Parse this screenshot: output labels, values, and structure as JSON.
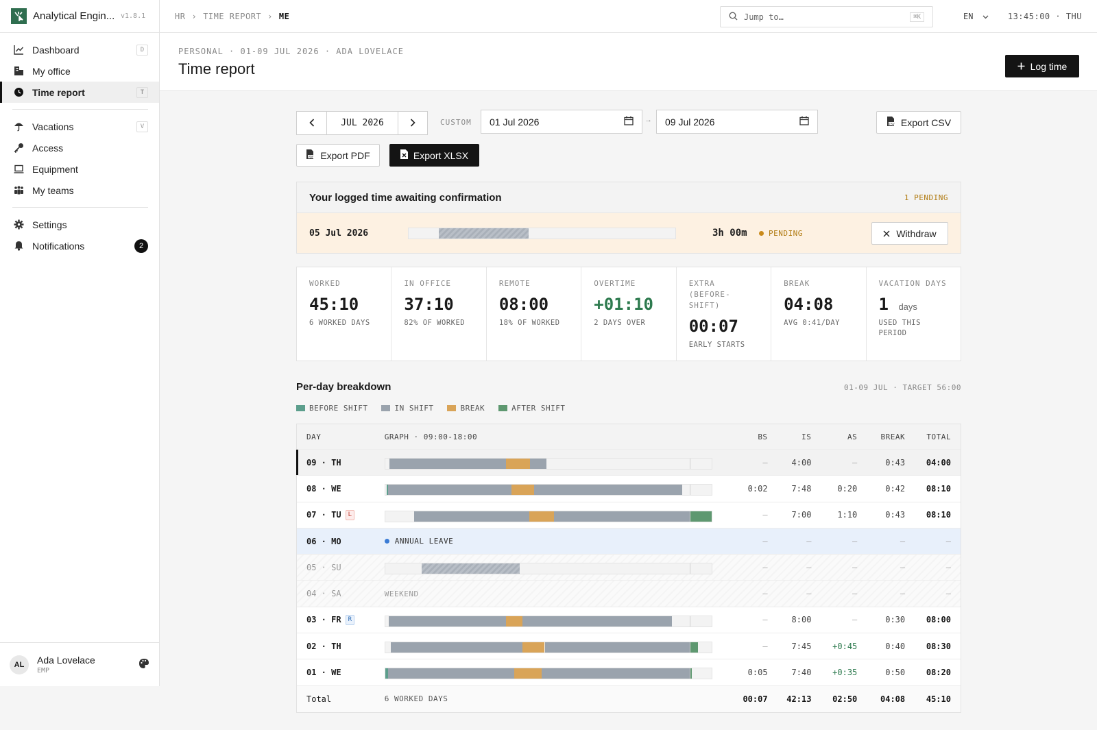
{
  "app": {
    "name": "Analytical Engin...",
    "version": "v1.8.1"
  },
  "sidebar": {
    "items": [
      {
        "label": "Dashboard",
        "kbd": "D",
        "icon": "chart-line-icon"
      },
      {
        "label": "My office",
        "kbd": "",
        "icon": "building-icon"
      },
      {
        "label": "Time report",
        "kbd": "T",
        "icon": "clock-icon"
      },
      {
        "label": "Vacations",
        "kbd": "V",
        "icon": "umbrella-icon"
      },
      {
        "label": "Access",
        "kbd": "",
        "icon": "key-icon"
      },
      {
        "label": "Equipment",
        "kbd": "",
        "icon": "laptop-icon"
      },
      {
        "label": "My teams",
        "kbd": "",
        "icon": "users-icon"
      },
      {
        "label": "Settings",
        "kbd": "",
        "icon": "gear-icon"
      },
      {
        "label": "Notifications",
        "badge": "2",
        "icon": "bell-icon"
      }
    ],
    "user": {
      "initials": "AL",
      "name": "Ada Lovelace",
      "role": "EMP"
    }
  },
  "topbar": {
    "breadcrumb": [
      "HR",
      "TIME REPORT",
      "ME"
    ],
    "search_placeholder": "Jump to…",
    "search_kbd": "⌘K",
    "lang": "EN",
    "clock": "13:45:00 · THU"
  },
  "page": {
    "pretitle": "PERSONAL · 01-09 JUL 2026 · ADA LOVELACE",
    "title": "Time report",
    "log_time": "Log time"
  },
  "controls": {
    "month": "JUL 2026",
    "range_label": "CUSTOM",
    "from": "01 Jul 2026",
    "to": "09 Jul 2026",
    "arrow": "→",
    "export_csv": "Export CSV",
    "export_pdf": "Export PDF",
    "export_xlsx": "Export XLSX"
  },
  "pending": {
    "title": "Your logged time awaiting confirmation",
    "count": "1 PENDING",
    "entry": {
      "date": "05 Jul 2026",
      "duration": "3h 00m",
      "status": "PENDING",
      "withdraw": "Withdraw"
    }
  },
  "stats": [
    {
      "label": "WORKED",
      "value": "45:10",
      "sub": "6 WORKED DAYS"
    },
    {
      "label": "IN OFFICE",
      "value": "37:10",
      "sub": "82% OF WORKED"
    },
    {
      "label": "REMOTE",
      "value": "08:00",
      "sub": "18% OF WORKED"
    },
    {
      "label": "OVERTIME",
      "value": "+01:10",
      "sub": "2 DAYS OVER"
    },
    {
      "label": "EXTRA (BEFORE-SHIFT)",
      "value": "00:07",
      "sub": "EARLY STARTS"
    },
    {
      "label": "BREAK",
      "value": "04:08",
      "sub": "AVG 0:41/DAY"
    },
    {
      "label": "VACATION DAYS",
      "value": "1",
      "unit": "days",
      "sub": "USED THIS PERIOD"
    }
  ],
  "breakdown": {
    "title": "Per-day breakdown",
    "meta": "01-09 JUL · TARGET 56:00",
    "legend": [
      {
        "label": "BEFORE SHIFT",
        "color": "#5c9e8c"
      },
      {
        "label": "IN SHIFT",
        "color": "#9aa3ad"
      },
      {
        "label": "BREAK",
        "color": "#d9a458"
      },
      {
        "label": "AFTER SHIFT",
        "color": "#5e9870"
      }
    ],
    "headers": {
      "day": "DAY",
      "graph": "GRAPH · 09:00-18:00",
      "bs": "BS",
      "is": "IS",
      "as": "AS",
      "break": "BREAK",
      "total": "TOTAL"
    },
    "rows": [
      {
        "day": "09 · TH",
        "bs": "–",
        "is": "4:00",
        "as": "–",
        "break": "0:43",
        "total": "04:00"
      },
      {
        "day": "08 · WE",
        "bs": "0:02",
        "is": "7:48",
        "as": "0:20",
        "break": "0:42",
        "total": "08:10"
      },
      {
        "day": "07 · TU",
        "tag": "L",
        "bs": "–",
        "is": "7:00",
        "as": "1:10",
        "break": "0:43",
        "total": "08:10"
      },
      {
        "day": "06 · MO",
        "note": "ANNUAL LEAVE",
        "bs": "–",
        "is": "–",
        "as": "–",
        "break": "–",
        "total": "–"
      },
      {
        "day": "05 · SU",
        "bs": "–",
        "is": "–",
        "as": "–",
        "break": "–",
        "total": "–"
      },
      {
        "day": "04 · SA",
        "note": "WEEKEND",
        "bs": "–",
        "is": "–",
        "as": "–",
        "break": "–",
        "total": "–"
      },
      {
        "day": "03 · FR",
        "tag": "R",
        "bs": "–",
        "is": "8:00",
        "as": "–",
        "break": "0:30",
        "total": "08:00"
      },
      {
        "day": "02 · TH",
        "bs": "–",
        "is": "7:45",
        "as": "+0:45",
        "break": "0:40",
        "total": "08:30"
      },
      {
        "day": "01 · WE",
        "bs": "0:05",
        "is": "7:40",
        "as": "+0:35",
        "break": "0:50",
        "total": "08:20"
      }
    ],
    "total_row": {
      "label": "Total",
      "days": "6 WORKED DAYS",
      "bs": "00:07",
      "is": "42:13",
      "as": "02:50",
      "break": "04:08",
      "total": "45:10"
    }
  }
}
